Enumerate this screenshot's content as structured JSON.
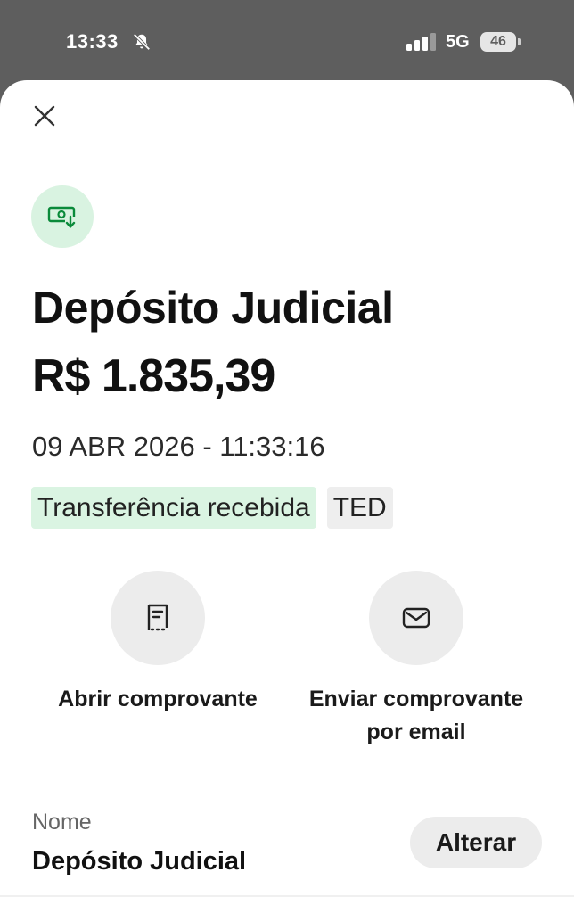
{
  "status_bar": {
    "time": "13:33",
    "network": "5G",
    "battery": "46",
    "icons": [
      "bell-muted-icon",
      "signal-icon",
      "battery-icon"
    ]
  },
  "sheet": {
    "close_icon": "close-icon",
    "transaction_icon": "money-received-icon",
    "title": "Depósito Judicial",
    "amount": "R$ 1.835,39",
    "datetime": "09 ABR 2026 - 11:33:16",
    "tags": [
      {
        "label": "Transferência recebida",
        "color": "#daf4e2"
      },
      {
        "label": "TED",
        "color": "#eeeeee"
      }
    ],
    "actions": [
      {
        "label": "Abrir comprovante",
        "icon": "receipt-icon"
      },
      {
        "label": "Enviar comprovante\npor email",
        "icon": "mail-icon"
      }
    ],
    "name_field": {
      "label": "Nome",
      "value": "Depósito Judicial",
      "button": "Alterar"
    }
  },
  "colors": {
    "accent_green": "#0a8a3a",
    "icon_bg_green": "#d9f3e1",
    "status_bar_bg": "#5e5e5e"
  }
}
